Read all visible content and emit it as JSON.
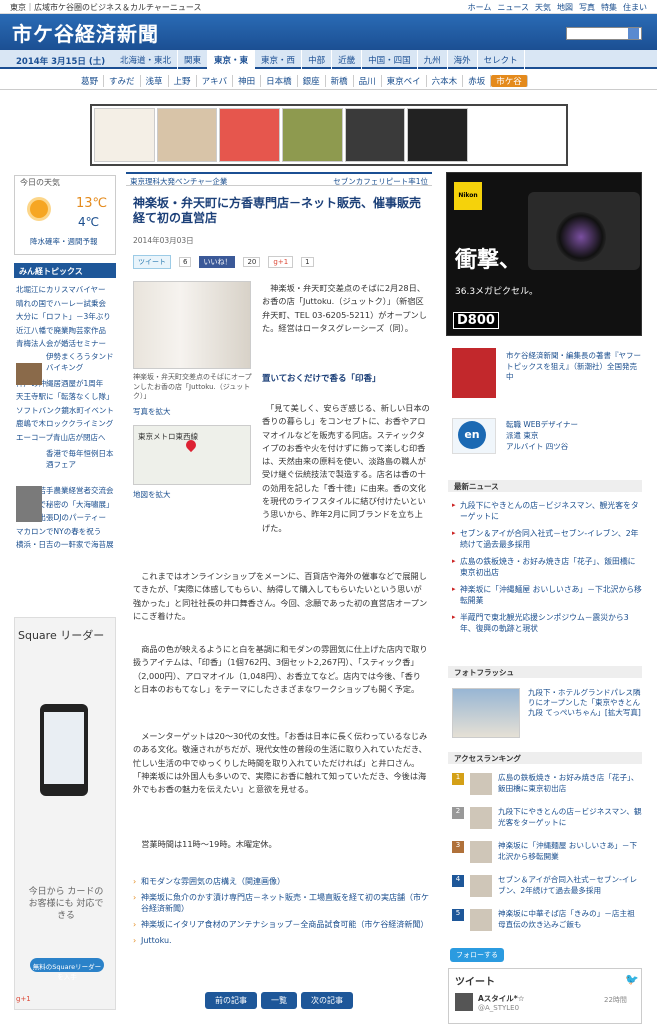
{
  "topbar": {
    "tagline": "東京｜広域市ケ谷圏のビジネス＆カルチャーニュース",
    "links": [
      "ホーム",
      "ニュース",
      "天気",
      "地図",
      "写真",
      "特集",
      "住まい"
    ]
  },
  "header": {
    "logo": "市ケ谷経済新聞"
  },
  "navbar": {
    "date": "2014年 3月15日 (土)",
    "items": [
      "北海道・東北",
      "関東",
      "東京・東",
      "東京・西",
      "中部",
      "近畿",
      "中国・四国",
      "九州",
      "海外",
      "セレクト"
    ],
    "active": "東京・東"
  },
  "subnav": {
    "items": [
      "葛野",
      "すみだ",
      "浅草",
      "上野",
      "アキバ",
      "神田",
      "日本橋",
      "銀座",
      "新橋",
      "品川",
      "東京ベイ",
      "六本木",
      "赤坂",
      "市ケ谷"
    ],
    "active": "市ケ谷"
  },
  "weather": {
    "title": "今日の天気",
    "high": "13℃",
    "low": "4℃",
    "link": "降水確率・週間予報"
  },
  "topics": {
    "title": "みん経トピックス",
    "items": [
      "北堀江にカリスマバイヤー",
      "晴れの国でハーレー試乗会",
      "大分に「ロフト」－3年ぶり",
      "近江八幡で廃業陶芸家作品",
      "青梅法人会が婚活セミナー",
      "伊勢まくろうタンドバイキング",
      "神戸の沖縄居酒屋が1周年",
      "天王寺駅に「転落なくし隊」",
      "ソフトバンク鏡水町イベント",
      "鹿嶋で木ロッククライミング",
      "エーコープ青山店が閉店へ",
      "香港で毎年恒例日本酒フェア",
      "徳島で若手農業経営者交流会",
      "小田急で秘密の「大海嘯展」",
      "大津で出張DJのパーティー",
      "マカロンでNYの春を祝う",
      "横浜・日吉の一軒家で海苔展"
    ]
  },
  "square": {
    "logo": "Square リーダー",
    "text": "今日から カードのお客様にも 対応できる",
    "button": "無料のSquareリーダーを入手",
    "gplus": "g+1"
  },
  "article": {
    "crumb_left": "東京理科大発ベンチャー企業",
    "crumb_right": "セブンカフェリピート率1位",
    "title": "神楽坂・弁天町に方香専門店－ネット販売、催事販売経て初の直営店",
    "date": "2014年03月03日",
    "share": {
      "tweet": "ツイート",
      "tweet_count": "6",
      "like": "いいね！",
      "like_count": "20",
      "gplus": "g+1",
      "gplus_count": "1"
    },
    "photo_caption": "神楽坂・弁天町交差点のそばにオープンしたお香の店「Juttoku.（ジュットク）」",
    "photo_link": "写真を拡大",
    "map_label": "東京メトロ東西線",
    "map_link": "地図を拡大",
    "p1": "　神楽坂・弁天町交差点のそばに2月28日、お香の店「Juttoku.（ジュットク）」（新宿区弁天町、TEL 03-6205-5211）がオープンした。経営はロータスグレーシーズ（同）。",
    "heading": "置いておくだけで香る「印香」",
    "p2": "　「見て美しく、安らぎ感じる、新しい日本の香りの暮らし」をコンセプトに、お香やアロマオイルなどを販売する同店。スティックタイプのお香や火を付けずに飾って楽しむ印香は、天然由来の原料を使い、淡路島の職人が受け継ぐ伝統技法で製造する。店名は香の十の効用を記した「香十徳」に由来。香の文化を現代のライフスタイルに結び付けたいという思いから、昨年2月に同ブランドを立ち上げた。",
    "p3": "　これまではオンラインショップをメーンに、百貨店や海外の催事などで展開してきたが、「実際に体感してもらい、納得して購入してもらいたいという思いが強かった」と同社社長の井口舞香さん。今回、念願であった初の直営店オープンにこぎ着けた。",
    "p4": "　商品の色が映えるようにと白を基調に和モダンの雰囲気に仕上げた店内で取り扱うアイテムは、「印香」（1個762円、3個セット2,267円）、「スティック香」（2,000円）、アロマオイル（1,048円）、お香立てなど。店内では今後、「香りと日本のおもてなし」をテーマにしたさまざまなワークショップも開く予定。",
    "p5": "　メーンターゲットは20～30代の女性。「お香は日本に長く伝わっているなじみのある文化。敬遠されがちだが、現代女性の普段の生活に取り入れていただき、忙しい生活の中でゆっくりした時間を取り入れていただければ」と井口さん。「神楽坂には外国人も多いので、実際にお香に触れて知っていただき、今後は海外でもお香の魅力を伝えたい」と意欲を見せる。",
    "p6": "　営業時間は11時～19時。木曜定休。",
    "related": [
      "和モダンな雰囲気の店構え（関連画像）",
      "神楽坂に魚介のかす漬け専門店－ネット販売・工場直販を経て初の実店舗（市ケ谷経済新聞）",
      "神楽坂にイタリア食材のアンテナショップ－全商品試食可能（市ケ谷経済新聞）",
      "Juttoku."
    ],
    "pager": [
      "前の記事",
      "一覧",
      "次の記事"
    ]
  },
  "right": {
    "nikon": {
      "brand": "Nikon",
      "slogan": "衝撃、",
      "sub": "36.3メガピクセル。",
      "model": "D800"
    },
    "book_text": "市ケ谷経済新聞・編集長の著書『ヤフートピックスを狙え』（新潮社）全国発売中",
    "en_text": [
      "転職 WEBデザイナー",
      "派遣 東京",
      "アルバイト 四ツ谷"
    ],
    "news_title": "最新ニュース",
    "news": [
      "九段下にやきとんの店－ビジネスマン、観光客をターゲットに",
      "セブン＆アイが合同入社式－セブン-イレブン、2年続けて過去最多採用",
      "広島の鉄板焼き・お好み焼き店「花子」、飯田橋に東京初出店",
      "神楽坂に「沖縄麺屋 おいしいさあ」－下北沢から移転開業",
      "半蔵門で東北観光応援シンポジウム－震災から3年、復興の軌跡と現状"
    ],
    "flash_title": "フォトフラッシュ",
    "flash_text": "九段下・ホテルグランドパレス隣りにオープンした「東京やきとん 九段 てっぺいちゃん」[拡大写真]",
    "rank_title": "アクセスランキング",
    "rank": [
      "広島の鉄板焼き・お好み焼き店「花子」、飯田橋に東京初出店",
      "九段下にやきとんの店－ビジネスマン、観光客をターゲットに",
      "神楽坂に「沖縄麺屋 おいしいさあ」－下北沢から移転開業",
      "セブン＆アイが合同入社式－セブン-イレブン、2年続けて過去最多採用",
      "神楽坂に中華そば店「きみの」－店主祖母直伝の炊き込みご飯も"
    ],
    "rank_nums": [
      "1",
      "2",
      "3",
      "4",
      "5"
    ],
    "follow": "フォローする",
    "tweet_title": "ツイート",
    "tweet_name": "Aスタイル*☆",
    "tweet_handle": "@A_STYLE0",
    "tweet_time": "22時間"
  }
}
